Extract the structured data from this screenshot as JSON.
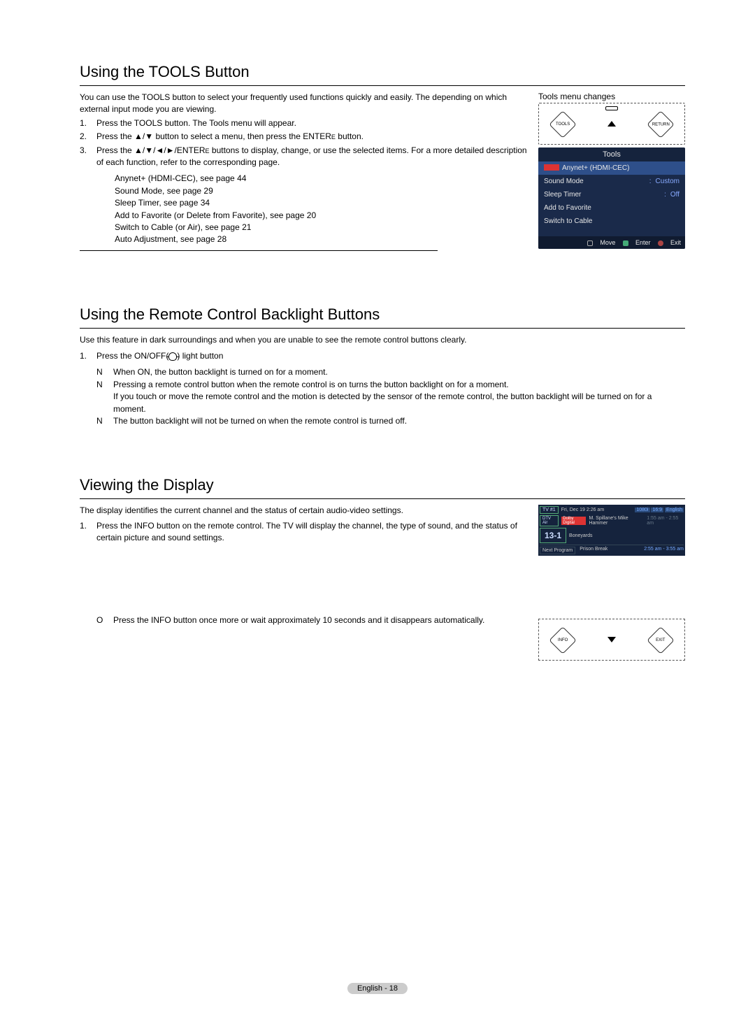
{
  "section1": {
    "heading": "Using the TOOLS Button",
    "intro": "You can use the  TOOLS button to select your frequently used functions quickly and easily. The depending on which external input mode you are viewing.",
    "tools_caption": "Tools  menu changes",
    "step1": "Press the TOOLS button. The Tools  menu will appear.",
    "step2_a": "Press the ▲/▼ button to select a menu, then press the ENTER",
    "step2_e": "E",
    "step2_b": "   button.",
    "step3_a": "Press the ▲/▼/◄/►/ENTER",
    "step3_e": "E",
    "step3_b": "    buttons to display, change, or use the selected items. For a more detailed description of each function, refer to the corresponding page.",
    "refs": [
      "Anynet+ (HDMI-CEC), see page 44",
      "Sound Mode, see page 29",
      "Sleep Timer, see page 34",
      "Add to Favorite (or Delete from Favorite), see page 20",
      "Switch to Cable (or Air), see page 21",
      "Auto Adjustment, see page 28"
    ],
    "remote_left_btn": "TOOLS",
    "remote_right_btn": "RETURN",
    "osd": {
      "title": "Tools",
      "rows": [
        {
          "label": "Anynet+ (HDMI-CEC)",
          "value": "",
          "hi": true,
          "tag": true
        },
        {
          "label": "Sound Mode",
          "value": "Custom"
        },
        {
          "label": "Sleep Timer",
          "value": "Off"
        },
        {
          "label": "Add to Favorite",
          "value": ""
        },
        {
          "label": "Switch to Cable",
          "value": ""
        }
      ],
      "foot_move": "Move",
      "foot_enter": "Enter",
      "foot_exit": "Exit"
    }
  },
  "section2": {
    "heading": "Using the Remote Control Backlight Buttons",
    "intro": "Use this feature in dark surroundings and when you are unable to see the remote control buttons clearly.",
    "step1": "Press the ON/OFF(",
    "step1b": ") light button",
    "notes": [
      "When ON, the button backlight is turned on for a moment.",
      "Pressing a remote control button when the remote control is on turns the button backlight on for a moment.\nIf you touch or move the remote control and the motion is detected by the sensor of the remote control, the button backlight will be turned on for a moment.",
      "The button backlight will not be turned on when the remote control is turned off."
    ]
  },
  "section3": {
    "heading": "Viewing the Display",
    "intro": "The display identifies the current channel and the status of certain audio-video settings.",
    "step1": "Press the INFO button on the remote control. The TV will display the channel, the type of sound, and the status of certain picture and sound settings.",
    "note_o": "Press the INFO button once more or wait approximately 10 seconds and it disappears automatically.",
    "remote_left_btn": "INFO",
    "remote_right_btn": "EXIT",
    "info": {
      "tv_label": "TV #1",
      "datetime": "Fri, Dec 19  2:26 am",
      "res": "1080i",
      "aspect": "16:9",
      "lang": "English",
      "air": "DTV Air",
      "dolby": "Dolby Digital",
      "show": "M. Spillane's Mike Hammer",
      "show_time": "1:55 am - 2:55 am",
      "channel": "13-1",
      "studio": "Boneyards",
      "next_label": "Next Program",
      "next_show": "Prison Break",
      "next_time": "2:55 am - 3:55 am"
    }
  },
  "footer": "English - 18"
}
